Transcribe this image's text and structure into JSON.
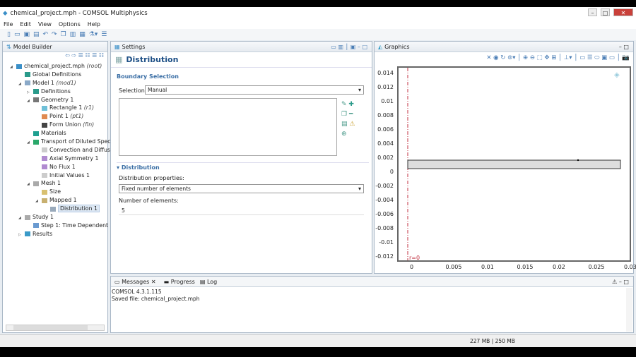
{
  "window": {
    "title": "chemical_project.mph - COMSOL Multiphysics",
    "min": "–",
    "max": "□",
    "close": "✕"
  },
  "menu": [
    "File",
    "Edit",
    "View",
    "Options",
    "Help"
  ],
  "model_builder": {
    "title": "Model Builder",
    "tree": [
      {
        "label": "chemical_project.mph",
        "tag": "(root)",
        "level": 0,
        "exp": "◢",
        "color": "#3a8fc8"
      },
      {
        "label": "Global Definitions",
        "tag": "",
        "level": 1,
        "exp": "",
        "color": "#2a9a8a"
      },
      {
        "label": "Model 1",
        "tag": "(mod1)",
        "level": 1,
        "exp": "◢",
        "color": "#8aa9c8"
      },
      {
        "label": "Definitions",
        "tag": "",
        "level": 2,
        "exp": "▷",
        "color": "#2a9a8a"
      },
      {
        "label": "Geometry 1",
        "tag": "",
        "level": 2,
        "exp": "◢",
        "color": "#777"
      },
      {
        "label": "Rectangle 1",
        "tag": "(r1)",
        "level": 3,
        "exp": "",
        "color": "#6fc0d8"
      },
      {
        "label": "Point 1",
        "tag": "(pt1)",
        "level": 3,
        "exp": "",
        "color": "#e08a50"
      },
      {
        "label": "Form Union",
        "tag": "(fin)",
        "level": 3,
        "exp": "",
        "color": "#444"
      },
      {
        "label": "Materials",
        "tag": "",
        "level": 2,
        "exp": "",
        "color": "#1fa090"
      },
      {
        "label": "Transport of Diluted Specie",
        "tag": "",
        "level": 2,
        "exp": "◢",
        "color": "#2aa86a"
      },
      {
        "label": "Convection and Diffusi",
        "tag": "",
        "level": 3,
        "exp": "",
        "color": "#ccc"
      },
      {
        "label": "Axial Symmetry 1",
        "tag": "",
        "level": 3,
        "exp": "",
        "color": "#b08ad0"
      },
      {
        "label": "No Flux 1",
        "tag": "",
        "level": 3,
        "exp": "",
        "color": "#b08ad0"
      },
      {
        "label": "Initial Values 1",
        "tag": "",
        "level": 3,
        "exp": "",
        "color": "#ccc"
      },
      {
        "label": "Mesh 1",
        "tag": "",
        "level": 2,
        "exp": "◢",
        "color": "#aaa"
      },
      {
        "label": "Size",
        "tag": "",
        "level": 3,
        "exp": "",
        "color": "#d8c070"
      },
      {
        "label": "Mapped 1",
        "tag": "",
        "level": 3,
        "exp": "◢",
        "color": "#c8b070"
      },
      {
        "label": "Distribution 1",
        "tag": "",
        "level": 4,
        "exp": "",
        "color": "#9ab",
        "selected": true
      },
      {
        "label": "Study 1",
        "tag": "",
        "level": 1,
        "exp": "◢",
        "color": "#aaa"
      },
      {
        "label": "Step 1: Time Dependent",
        "tag": "",
        "level": 2,
        "exp": "",
        "color": "#6a9ad0"
      },
      {
        "label": "Results",
        "tag": "",
        "level": 1,
        "exp": "▷",
        "color": "#3a9ac8"
      }
    ]
  },
  "settings": {
    "tab": "Settings",
    "title": "Distribution",
    "boundary_section": "Boundary Selection",
    "selection_label": "Selection:",
    "selection_value": "Manual",
    "distribution_section": "Distribution",
    "dist_props_label": "Distribution properties:",
    "dist_props_value": "Fixed number of elements",
    "num_elements_label": "Number of elements:",
    "num_elements_value": "5"
  },
  "graphics": {
    "tab": "Graphics",
    "y_ticks": [
      "0.014",
      "0.012",
      "0.01",
      "0.008",
      "0.006",
      "0.004",
      "0.002",
      "0",
      "-0.002",
      "-0.004",
      "-0.006",
      "-0.008",
      "-0.01",
      "-0.012"
    ],
    "x_ticks": [
      "0",
      "0.005",
      "0.01",
      "0.015",
      "0.02",
      "0.025",
      "0.03"
    ],
    "axis_label": "r=0"
  },
  "messages": {
    "tabs": [
      "Messages",
      "Progress",
      "Log"
    ],
    "lines": [
      "COMSOL 4.3.1.115",
      "Saved file: chemical_project.mph"
    ]
  },
  "status": {
    "memory": "227 MB | 250 MB"
  }
}
